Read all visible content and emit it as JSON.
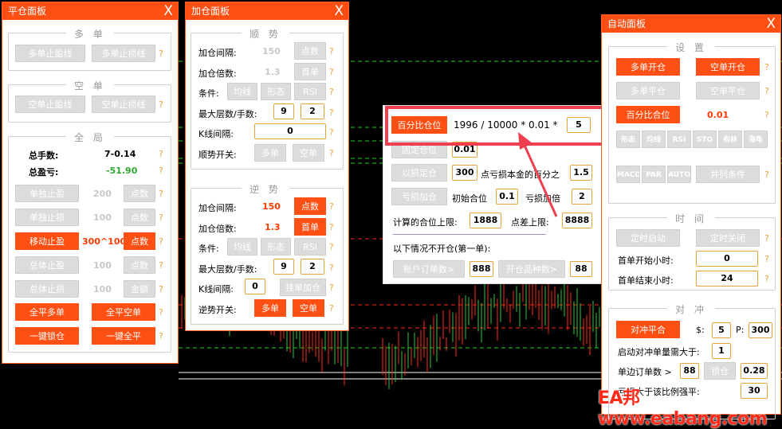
{
  "close_glyph": "X",
  "help_glyph": "?",
  "ping": {
    "title": "平仓面板",
    "duo": {
      "title": "多 单",
      "tp": "多单止盈线",
      "sl": "多单止损线"
    },
    "kong": {
      "title": "空 单",
      "tp": "空单止盈线",
      "sl": "空单止损线"
    },
    "quanju": {
      "title": "全 局",
      "lots_label": "总手数:",
      "lots_value": "7-0.14",
      "pnl_label": "总盈亏:",
      "pnl_value": "-51.90",
      "rows": [
        {
          "btn": "单独止盈",
          "value": "200",
          "unit": "点数",
          "active": false
        },
        {
          "btn": "单独止损",
          "value": "100",
          "unit": "点数",
          "active": false
        },
        {
          "btn": "移动止盈",
          "value": "300^100",
          "unit": "点数",
          "active": true
        },
        {
          "btn": "总体止盈",
          "value": "100",
          "unit": "点数",
          "active": false
        },
        {
          "btn": "总体止损",
          "value": "100",
          "unit": "金额",
          "active": false
        }
      ],
      "close_long": "全平多单",
      "close_short": "全平空单",
      "lock": "一键锁仓",
      "close_all": "一键全平"
    }
  },
  "jia": {
    "title": "加仓面板",
    "shun": {
      "title": "顺 势",
      "interval_label": "加仓间隔:",
      "interval_value": "150",
      "interval_unit": "点数",
      "mult_label": "加仓倍数:",
      "mult_value": "1.3",
      "mult_unit": "首单",
      "cond_label": "条件:",
      "cond1": "均线",
      "cond2": "形态",
      "cond3": "RSI",
      "max_label": "最大层数/手数:",
      "max_layers": "9",
      "max_lots": "2",
      "k_label": "K线间隔:",
      "k_value": "0",
      "open_label": "顺势开关:",
      "open_long": "多单",
      "open_short": "空单"
    },
    "ni": {
      "title": "逆 势",
      "interval_label": "加仓间隔:",
      "interval_value": "150",
      "interval_unit": "点数",
      "mult_label": "加仓倍数:",
      "mult_value": "1.3",
      "mult_unit": "首单",
      "cond_label": "条件:",
      "cond1": "均线",
      "cond2": "形态",
      "cond3": "RSI",
      "max_label": "最大层数/手数:",
      "max_layers": "9",
      "max_lots": "2",
      "k_label": "K线间隔:",
      "k_value": "0",
      "k_btn": "挂单加仓",
      "open_label": "逆势开关:",
      "open_long": "多单",
      "open_short": "空单"
    }
  },
  "pct": {
    "btn": "百分比仓位",
    "formula": "1996 / 10000 * 0.01 *",
    "value": "5",
    "fixed_btn": "固定仓位",
    "fixed_value": "0.01",
    "sl_btn": "以损定仓",
    "sl_value": "300",
    "sl_label": "点亏损本金的百分之",
    "sl_pct": "1.5",
    "loss_btn": "亏损加仓",
    "init_label": "初始合位",
    "init_value": "0.1",
    "loss_label": "亏损加倍",
    "loss_value": "2",
    "calc_label": "计算的合位上限:",
    "calc_value": "1888",
    "spread_label": "点差上限:",
    "spread_value": "8888",
    "no_open_label": "以下情况不开仓(第一单):",
    "acct_btn": "账户订单数>",
    "acct_value": "888",
    "sym_btn": "开仓品种数>",
    "sym_value": "88"
  },
  "auto": {
    "title": "自动面板",
    "setup": {
      "title": "设 置",
      "long_open": "多单开仓",
      "short_open": "空单开仓",
      "long_close": "多单平仓",
      "short_close": "空单平仓",
      "pct_btn": "百分比合位",
      "pct_value": "0.01",
      "ind": [
        "形态",
        "均线",
        "RSI",
        "STO",
        "布林",
        "海龟"
      ],
      "ind2": [
        "MACD",
        "PAR",
        "AUTO"
      ],
      "combo": "并列条件"
    },
    "time": {
      "title": "时 间",
      "start": "定时启动",
      "stop": "定时关闭",
      "first_label": "首单开始小时:",
      "first_value": "0",
      "end_label": "首单结束小时:",
      "end_value": "24"
    },
    "hedge": {
      "title": "对 冲",
      "btn": "对冲平合",
      "dollar_label": "$:",
      "dollar_value": "5",
      "p_label": "P:",
      "p_value": "300",
      "start_label": "启动对冲单量需大于:",
      "start_value": "1",
      "side_label": "单边订单数 >",
      "side_value": "88",
      "lock_btn": "锁仓",
      "lock_value": "0.28",
      "ratio_label": "亏损大于该比例强平:",
      "ratio_value": "30"
    }
  },
  "watermark": "EA邦 www.eabang.com",
  "chart_colors": {
    "bull": "#2ecc40",
    "bear": "#ff2a1a",
    "grid": "#1fd11f",
    "level": "#ff2a1a"
  }
}
